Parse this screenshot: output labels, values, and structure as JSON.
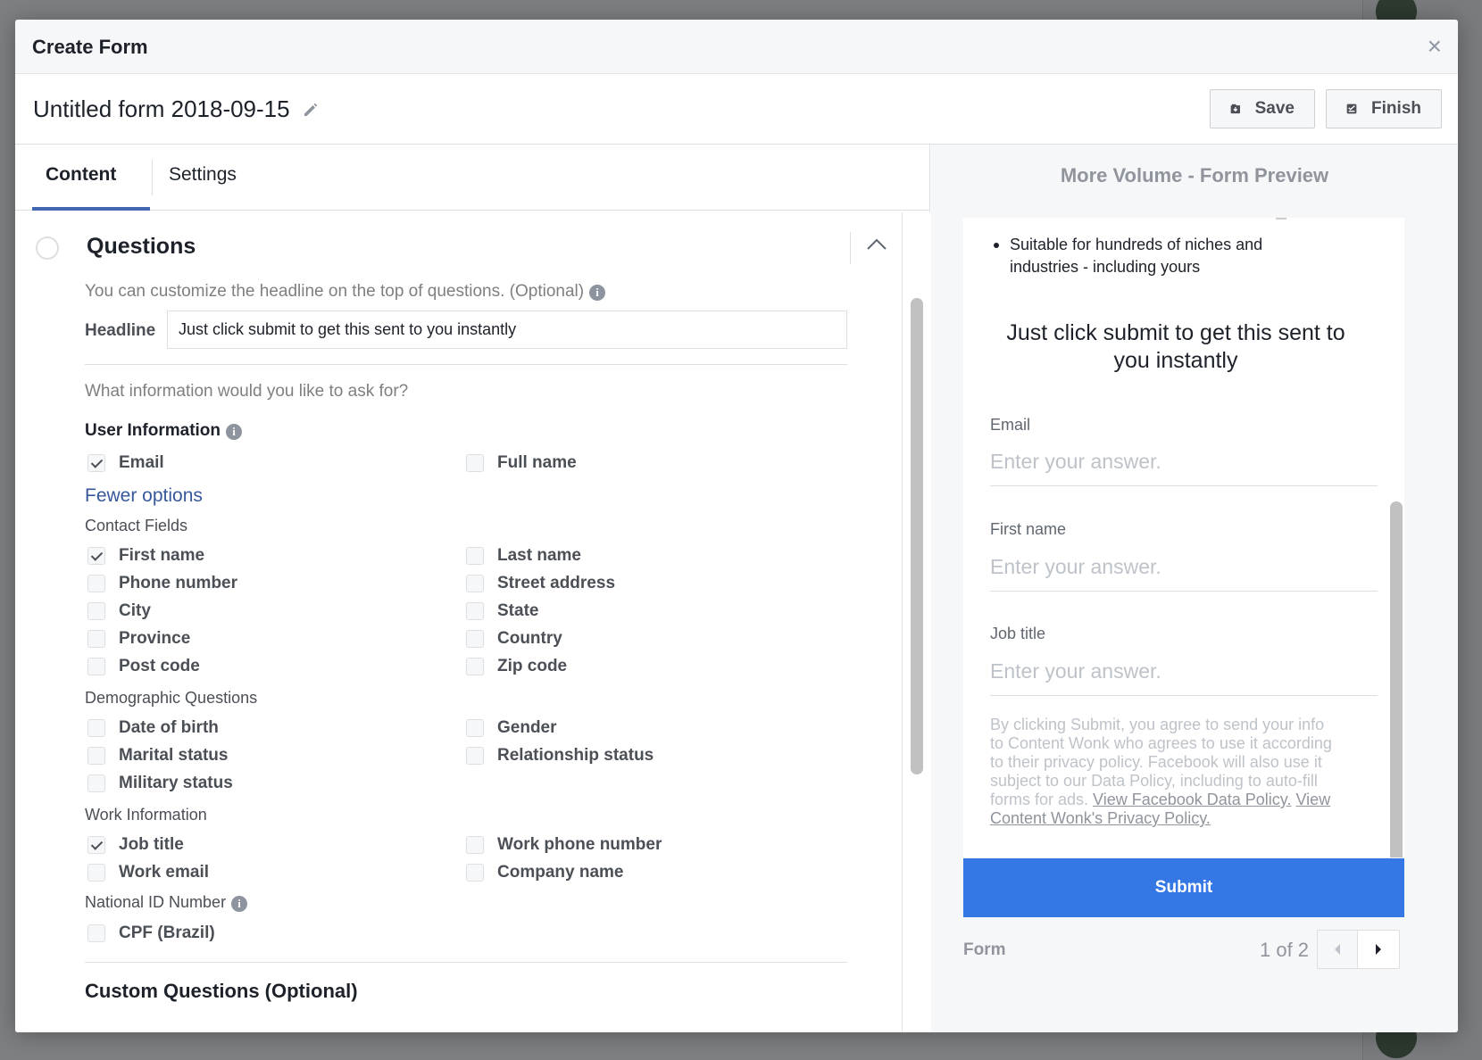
{
  "modal": {
    "title": "Create Form",
    "close_glyph": "×"
  },
  "form": {
    "name": "Untitled form 2018-09-15",
    "save_label": "Save",
    "finish_label": "Finish"
  },
  "tabs": [
    {
      "label": "Content",
      "active": true
    },
    {
      "label": "Settings",
      "active": false
    }
  ],
  "questions": {
    "title": "Questions",
    "headline_hint": "You can customize the headline on the top of questions. (Optional)",
    "headline_label": "Headline",
    "headline_value": "Just click submit to get this sent to you instantly",
    "ask_hint": "What information would you like to ask for?",
    "user_info_title": "User Information",
    "user_info": [
      {
        "label": "Email",
        "checked": true
      },
      {
        "label": "Full name",
        "checked": false
      }
    ],
    "fewer_options": "Fewer options",
    "contact_title": "Contact Fields",
    "contact": [
      {
        "label": "First name",
        "checked": true
      },
      {
        "label": "Last name",
        "checked": false
      },
      {
        "label": "Phone number",
        "checked": false
      },
      {
        "label": "Street address",
        "checked": false
      },
      {
        "label": "City",
        "checked": false
      },
      {
        "label": "State",
        "checked": false
      },
      {
        "label": "Province",
        "checked": false
      },
      {
        "label": "Country",
        "checked": false
      },
      {
        "label": "Post code",
        "checked": false
      },
      {
        "label": "Zip code",
        "checked": false
      }
    ],
    "demographic_title": "Demographic Questions",
    "demographic": [
      {
        "label": "Date of birth",
        "checked": false
      },
      {
        "label": "Gender",
        "checked": false
      },
      {
        "label": "Marital status",
        "checked": false
      },
      {
        "label": "Relationship status",
        "checked": false
      },
      {
        "label": "Military status",
        "checked": false
      }
    ],
    "work_title": "Work Information",
    "work": [
      {
        "label": "Job title",
        "checked": true
      },
      {
        "label": "Work phone number",
        "checked": false
      },
      {
        "label": "Work email",
        "checked": false
      },
      {
        "label": "Company name",
        "checked": false
      }
    ],
    "national_title": "National ID Number",
    "national": [
      {
        "label": "CPF (Brazil)",
        "checked": false
      }
    ],
    "custom_title": "Custom Questions (Optional)"
  },
  "preview": {
    "title": "More Volume - Form Preview",
    "bullet": "Suitable for hundreds of niches and industries - including yours",
    "headline": "Just click submit to get this sent to you instantly",
    "fields": [
      {
        "label": "Email",
        "placeholder": "Enter your answer."
      },
      {
        "label": "First name",
        "placeholder": "Enter your answer."
      },
      {
        "label": "Job title",
        "placeholder": "Enter your answer."
      }
    ],
    "disclaimer_text": "By clicking Submit, you agree to send your info to Content Wonk who agrees to use it according to their privacy policy. Facebook will also use it subject to our Data Policy, including to auto-fill forms for ads. ",
    "disclaimer_link1": "View Facebook Data Policy.",
    "disclaimer_link2": "View Content Wonk's Privacy Policy.",
    "submit_label": "Submit",
    "pager_label": "Form",
    "pager_count": "1 of 2"
  },
  "colors": {
    "accent": "#4267b2",
    "submit": "#3578e5",
    "link": "#365899"
  }
}
